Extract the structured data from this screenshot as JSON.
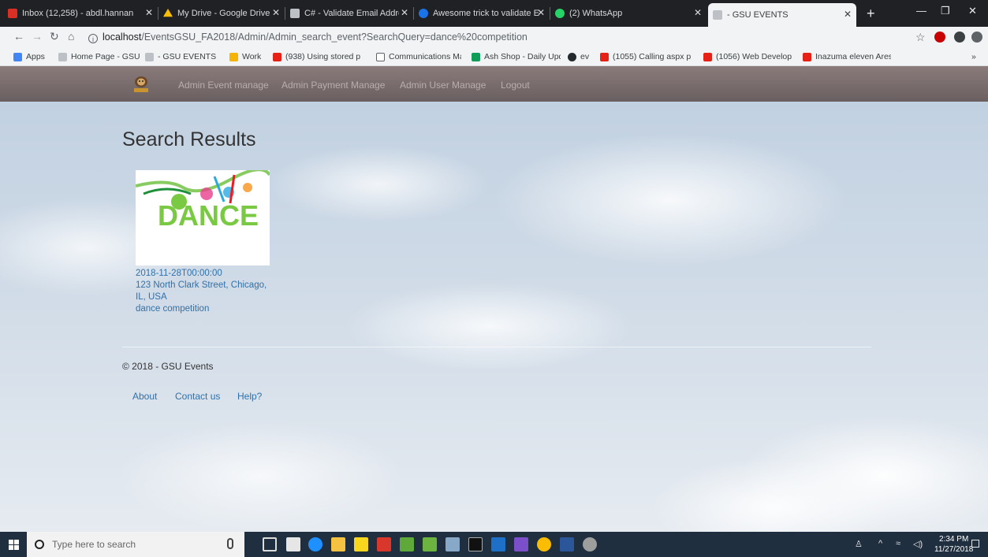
{
  "browser": {
    "tabs": [
      {
        "title": "Inbox (12,258) - abdl.hannan",
        "icon": "gmail-icon",
        "color": "#d93025"
      },
      {
        "title": "My Drive - Google Drive",
        "icon": "drive-icon",
        "color": "#fbbc04"
      },
      {
        "title": "C# - Validate Email Address",
        "icon": "page-icon",
        "color": "#bdc1c6"
      },
      {
        "title": "Awesome trick to validate Em",
        "icon": "wordpress-icon",
        "color": "#1a73e8"
      },
      {
        "title": "(2) WhatsApp",
        "icon": "whatsapp-icon",
        "color": "#25d366"
      },
      {
        "title": "- GSU EVENTS",
        "icon": "page-icon",
        "color": "#bdc1c6",
        "active": true
      }
    ],
    "new_tab": "+",
    "window_controls": {
      "minimize": "—",
      "restore": "❐",
      "close": "✕"
    },
    "address": {
      "host": "localhost",
      "path": "/EventsGSU_FA2018/Admin/Admin_search_event?SearchQuery=dance%20competition"
    },
    "bookmarks": [
      {
        "label": "Apps",
        "icon": "apps-grid-icon",
        "color": "#4285f4"
      },
      {
        "label": "Home Page - GSU EV",
        "icon": "page-icon",
        "color": "#bdc1c6"
      },
      {
        "label": "- GSU EVENTS",
        "icon": "page-icon",
        "color": "#bdc1c6"
      },
      {
        "label": "Work",
        "icon": "folder-icon",
        "color": "#f4b400"
      },
      {
        "label": "(938) Using stored p",
        "icon": "youtube-icon",
        "color": "#e62117"
      },
      {
        "label": "Communications Ma",
        "icon": "document-icon",
        "color": "#ffffff"
      },
      {
        "label": "Ash Shop - Daily Upd",
        "icon": "sheets-icon",
        "color": "#0f9d58"
      },
      {
        "label": "ev",
        "icon": "github-icon",
        "color": "#24292e"
      },
      {
        "label": "(1055) Calling aspx p",
        "icon": "youtube-icon",
        "color": "#e62117"
      },
      {
        "label": "(1056) Web Develop",
        "icon": "youtube-icon",
        "color": "#e62117"
      },
      {
        "label": "Inazuma eleven Ares",
        "icon": "youtube-icon",
        "color": "#e62117"
      }
    ],
    "bookmarks_overflow": "»"
  },
  "site": {
    "nav": [
      "Admin Event manage",
      "Admin Payment Manage",
      "Admin User Manage",
      "Logout"
    ],
    "title": "Search Results",
    "event": {
      "image_text": "DANCE",
      "date": "2018-11-28T00:00:00",
      "address_line1": "123 North Clark Street, Chicago,",
      "address_line2": "IL, USA",
      "name": "dance competition"
    },
    "footer": {
      "copyright": "© 2018 - GSU Events",
      "links": [
        "About",
        "Contact us",
        "Help?"
      ]
    }
  },
  "taskbar": {
    "search_placeholder": "Type here to search",
    "clock_time": "2:34 PM",
    "clock_date": "11/27/2018"
  }
}
